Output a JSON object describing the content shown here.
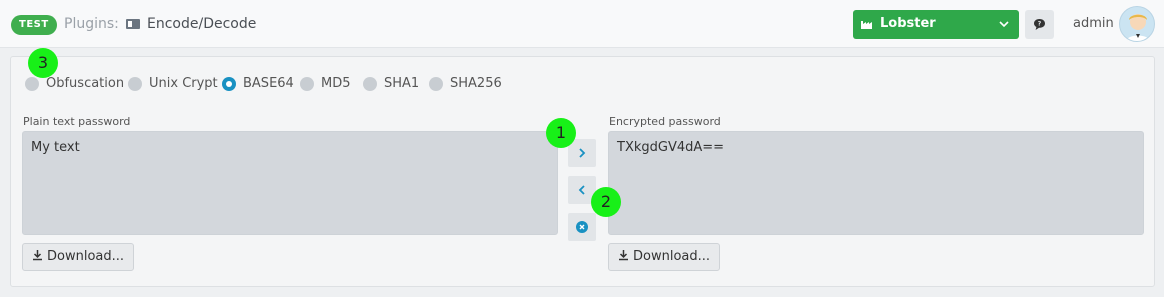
{
  "header": {
    "env_badge": "TEST",
    "plugins_label": "Plugins:",
    "plugin_name": "Encode/Decode",
    "environment": "Lobster",
    "user": "admin"
  },
  "algorithms": [
    {
      "label": "Obfuscation",
      "checked": false
    },
    {
      "label": "Unix Crypt",
      "checked": false
    },
    {
      "label": "BASE64",
      "checked": true
    },
    {
      "label": "MD5",
      "checked": false
    },
    {
      "label": "SHA1",
      "checked": false
    },
    {
      "label": "SHA256",
      "checked": false
    }
  ],
  "plain": {
    "label": "Plain text password",
    "value": "My text",
    "download_label": "Download..."
  },
  "encrypted": {
    "label": "Encrypted password",
    "value": "TXkgdGV4dA==",
    "download_label": "Download..."
  },
  "markers": [
    "1",
    "2",
    "3"
  ],
  "colors": {
    "accent": "#1991c2",
    "env_green": "#2fa84a",
    "marker": "#18f018"
  }
}
